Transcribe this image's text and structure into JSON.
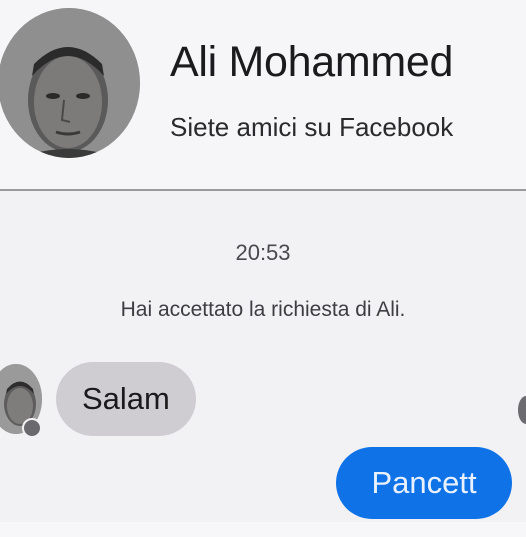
{
  "header": {
    "name": "Ali Mohammed",
    "subtitle": "Siete amici su Facebook"
  },
  "conversation": {
    "timestamp": "20:53",
    "system_message": "Hai accettato la richiesta di Ali.",
    "messages": [
      {
        "direction": "incoming",
        "text": "Salam"
      },
      {
        "direction": "outgoing",
        "text": "Pancett"
      }
    ]
  },
  "colors": {
    "outgoing_bubble": "#0f73e7",
    "incoming_bubble": "#cfcdd1",
    "background": "#f2f1f4"
  }
}
